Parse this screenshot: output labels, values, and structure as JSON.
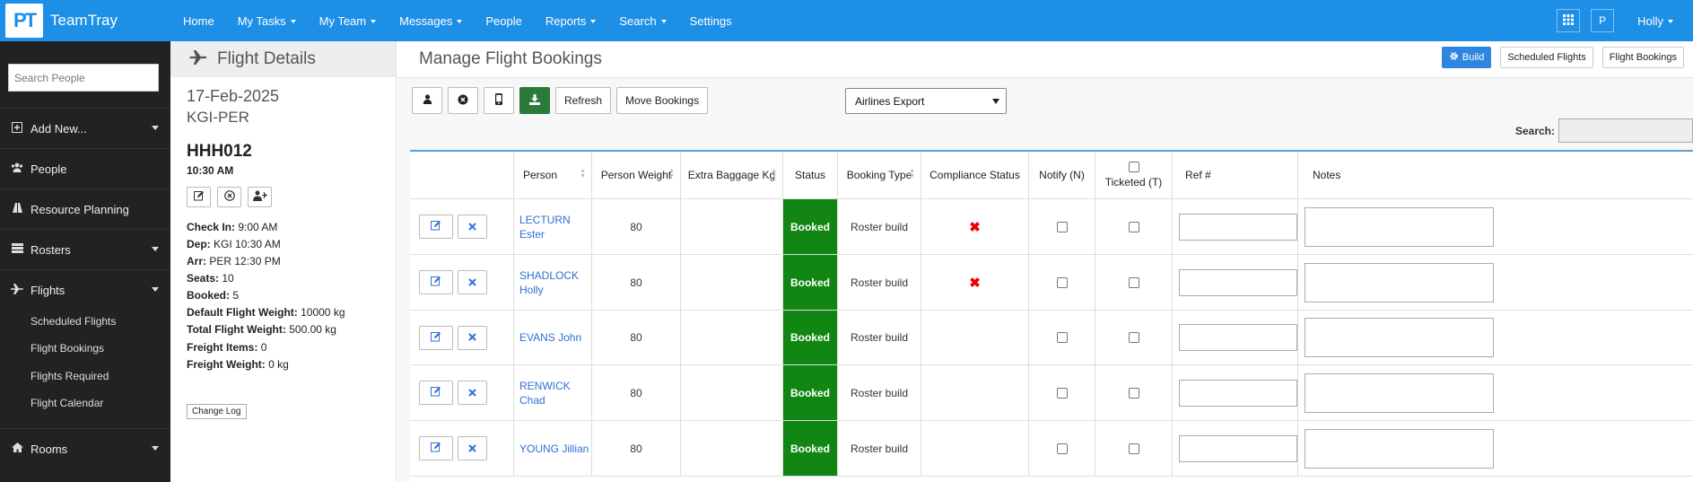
{
  "topbar": {
    "logo_mark": "PT",
    "app_name": "TeamTray",
    "nav": [
      "Home",
      "My Tasks",
      "My Team",
      "Messages",
      "People",
      "Reports",
      "Search",
      "Settings"
    ],
    "nav_dropdown": [
      false,
      true,
      true,
      true,
      false,
      true,
      true,
      false
    ],
    "user_initial": "P",
    "user_name": "Holly",
    "grid_icon": "grid-icon"
  },
  "sidebar": {
    "search_placeholder": "Search People",
    "items": [
      {
        "label": "Add New...",
        "icon": "plus-square-icon"
      },
      {
        "label": "People",
        "icon": "users-icon"
      },
      {
        "label": "Resource Planning",
        "icon": "road-icon"
      },
      {
        "label": "Rosters",
        "icon": "list-icon"
      },
      {
        "label": "Flights",
        "icon": "plane-icon"
      },
      {
        "label": "Rooms",
        "icon": "home-icon"
      }
    ],
    "sub_items": [
      "Scheduled Flights",
      "Flight Bookings",
      "Flights Required",
      "Flight Calendar"
    ]
  },
  "flight_details": {
    "title": "Flight Details",
    "date": "17-Feb-2025",
    "route": "KGI-PER",
    "flight_code": "HHH012",
    "time": "10:30 AM",
    "fields": [
      {
        "label": "Check In:",
        "value": "9:00 AM"
      },
      {
        "label": "Dep:",
        "value": "KGI 10:30 AM"
      },
      {
        "label": "Arr:",
        "value": "PER 12:30 PM"
      },
      {
        "label": "Seats:",
        "value": "10"
      },
      {
        "label": "Booked:",
        "value": "5"
      },
      {
        "label": "Default Flight Weight:",
        "value": "10000 kg"
      },
      {
        "label": "Total Flight Weight:",
        "value": "500.00 kg"
      },
      {
        "label": "Freight Items:",
        "value": "0"
      },
      {
        "label": "Freight Weight:",
        "value": "0 kg"
      }
    ],
    "change_log": "Change Log"
  },
  "main": {
    "title": "Manage Flight Bookings",
    "header_buttons": {
      "build": "Build",
      "scheduled": "Scheduled Flights",
      "bookings": "Flight Bookings"
    },
    "toolbar": {
      "refresh": "Refresh",
      "move": "Move Bookings"
    },
    "export_select": "Airlines Export",
    "search_label": "Search:",
    "columns": [
      "Person",
      "Person Weight",
      "Extra Baggage Kg",
      "Status",
      "Booking Type",
      "Compliance Status",
      "Notify (N)",
      "Ticketed (T)",
      "Ref #",
      "Notes"
    ],
    "rows": [
      {
        "person": "LECTURN Ester",
        "weight": "80",
        "baggage": "",
        "status": "Booked",
        "type": "Roster build",
        "non_compliant": true
      },
      {
        "person": "SHADLOCK Holly",
        "weight": "80",
        "baggage": "",
        "status": "Booked",
        "type": "Roster build",
        "non_compliant": true
      },
      {
        "person": "EVANS John",
        "weight": "80",
        "baggage": "",
        "status": "Booked",
        "type": "Roster build",
        "non_compliant": false
      },
      {
        "person": "RENWICK Chad",
        "weight": "80",
        "baggage": "",
        "status": "Booked",
        "type": "Roster build",
        "non_compliant": false
      },
      {
        "person": "YOUNG Jillian",
        "weight": "80",
        "baggage": "",
        "status": "Booked",
        "type": "Roster build",
        "non_compliant": false
      }
    ],
    "status_color": "#128612"
  }
}
